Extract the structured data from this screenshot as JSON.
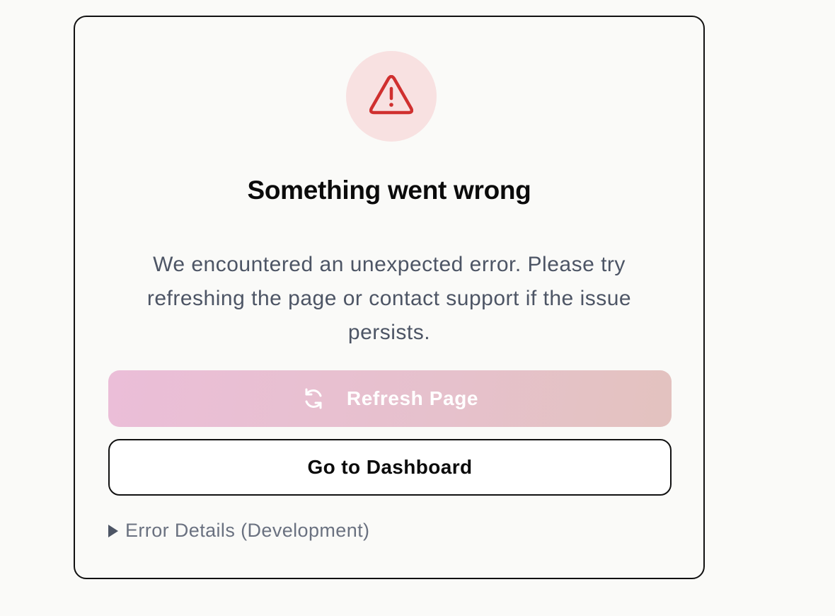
{
  "error_card": {
    "icon": "warning-triangle-icon",
    "title": "Something went wrong",
    "message": "We encountered an unexpected error. Please try refreshing the page or contact support if the issue persists.",
    "refresh_button": {
      "icon": "refresh-icon",
      "label": "Refresh Page"
    },
    "dashboard_button": {
      "label": "Go to Dashboard"
    },
    "details_toggle": {
      "icon": "triangle-right-icon",
      "label": "Error Details (Development)"
    }
  },
  "colors": {
    "page_background": "#fafaf8",
    "icon_circle": "#f8e1e1",
    "icon_stroke": "#d0302f",
    "title": "#0b0b0b",
    "message": "#4d5565",
    "refresh_gradient_start": "#ebbed8",
    "refresh_gradient_end": "#e3c2bf",
    "details_text": "#6a7180"
  }
}
